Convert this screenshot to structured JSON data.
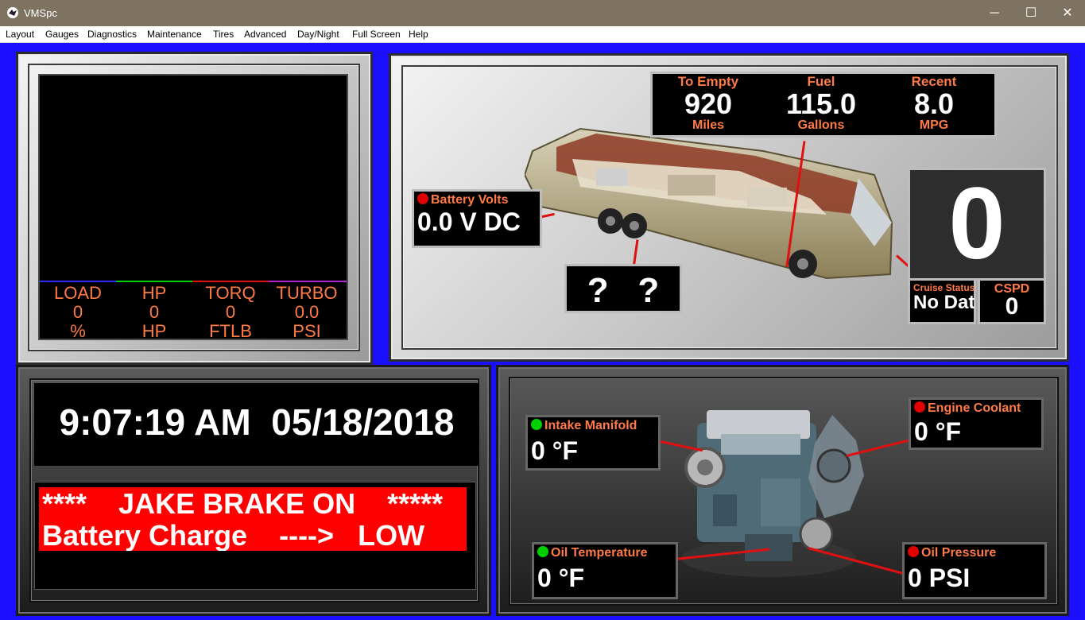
{
  "window": {
    "title": "VMSpc",
    "minimize": "─",
    "maximize": "☐",
    "close": "✕"
  },
  "menu": [
    "Layout",
    "Gauges",
    "Diagnostics",
    "Maintenance",
    "Tires",
    "Advanced",
    "Day/Night",
    "Full Screen",
    "Help"
  ],
  "gauges": [
    {
      "label": "LOAD",
      "value": "0",
      "unit": "%",
      "color": "#2b2bff"
    },
    {
      "label": "HP",
      "value": "0",
      "unit": "HP",
      "color": "#00d000"
    },
    {
      "label": "TORQ",
      "value": "0",
      "unit": "FTLB",
      "color": "#e01010"
    },
    {
      "label": "TURBO",
      "value": "0.0",
      "unit": "PSI",
      "color": "#b020d0"
    }
  ],
  "fuel": [
    {
      "label": "To Empty",
      "value": "920",
      "unit": "Miles"
    },
    {
      "label": "Fuel",
      "value": "115.0",
      "unit": "Gallons"
    },
    {
      "label": "Recent",
      "value": "8.0",
      "unit": "MPG"
    }
  ],
  "battery": {
    "label": "Battery Volts",
    "value": "0.0 V DC"
  },
  "unknown": {
    "value": "?   ?"
  },
  "speed": {
    "value": "0"
  },
  "cruise": {
    "label": "Cruise Status",
    "value": "No Dat"
  },
  "cspd": {
    "label": "CSPD",
    "value": "0"
  },
  "clock": {
    "time": "9:07:19 AM",
    "date": "05/18/2018"
  },
  "alerts": {
    "line1": "****    JAKE BRAKE ON    *****",
    "line2": "Battery Charge    ---->   LOW"
  },
  "engine": {
    "intake": {
      "label": "Intake Manifold",
      "value": "0 °F"
    },
    "coolant": {
      "label": "Engine Coolant",
      "value": "0 °F"
    },
    "oil_temp": {
      "label": "Oil Temperature",
      "value": "0 °F"
    },
    "oil_press": {
      "label": "Oil Pressure",
      "value": "0 PSI"
    }
  }
}
